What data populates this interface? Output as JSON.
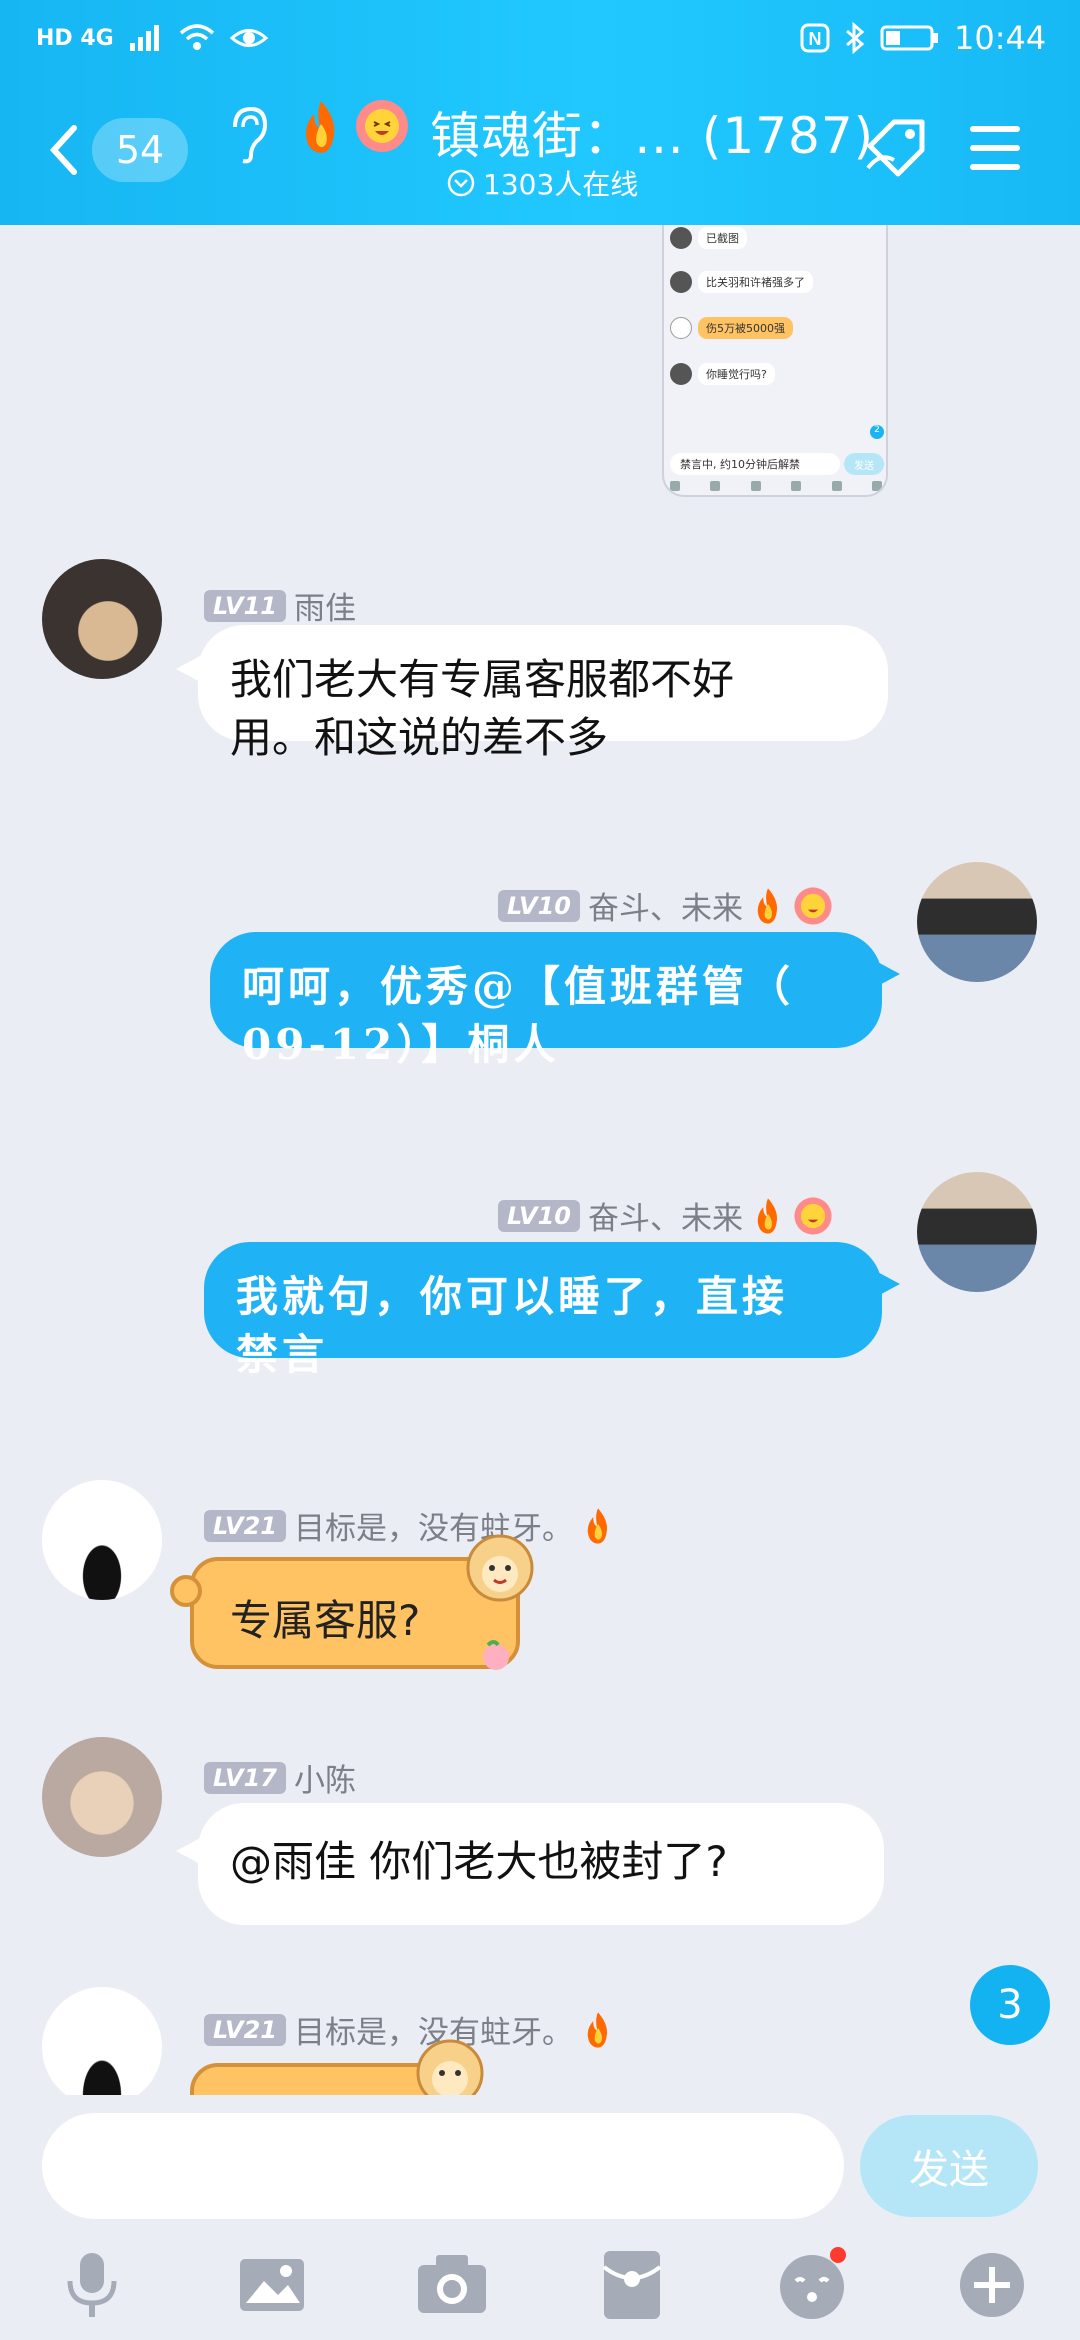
{
  "status_bar": {
    "network": "HD 4G",
    "time": "10:44"
  },
  "header": {
    "unread_count": "54",
    "title": "镇魂街：… (1787)",
    "online": "1303人在线"
  },
  "preview": {
    "lines": [
      "已截图",
      "比关羽和许褚强多了",
      "伤5万被5000强",
      "你睡觉行吗?",
      "禁言中, 约10分钟后解禁"
    ],
    "send": "发送",
    "counter": "2"
  },
  "messages": [
    {
      "level": "LV11",
      "name": "雨佳",
      "text_lines": [
        "我们老大有专属客服都不好",
        "用。和这说的差不多"
      ]
    },
    {
      "level": "LV10",
      "name": "奋斗、未来",
      "text_lines": [
        "呵呵，优秀@【值班群管（",
        "09-12）】桐人"
      ]
    },
    {
      "level": "LV10",
      "name": "奋斗、未来",
      "text_lines": [
        "我就句，你可以睡了，直接",
        "禁言"
      ]
    },
    {
      "level": "LV21",
      "name": "目标是，没有蛀牙。",
      "text": "专属客服?"
    },
    {
      "level": "LV17",
      "name": "小陈",
      "text": "@雨佳 你们老大也被封了?"
    },
    {
      "level": "LV21",
      "name": "目标是，没有蛀牙。"
    }
  ],
  "unread_bubble": "3",
  "input": {
    "placeholder": "",
    "send_label": "发送"
  },
  "toolbar": [
    "mic-icon",
    "image-icon",
    "camera-icon",
    "redpacket-icon",
    "emoji-icon",
    "plus-icon"
  ],
  "colors": {
    "header": "#1bbdf7",
    "blue_bubble": "#1fb3f5",
    "orange_bubble": "#ffc364",
    "background": "#ebedf5"
  }
}
